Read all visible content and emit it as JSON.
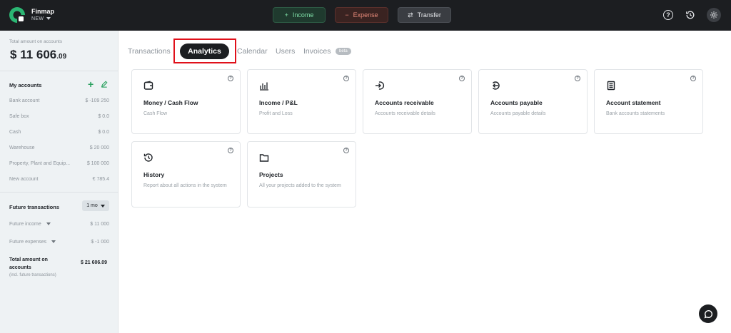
{
  "brand": {
    "name": "Finmap",
    "workspace": "NEW"
  },
  "topbar": {
    "income_label": "Income",
    "expense_label": "Expense",
    "transfer_label": "Transfer",
    "income_icon": "+",
    "expense_icon": "−",
    "transfer_icon": "⇄"
  },
  "sidebar": {
    "total_label": "Total amount on accounts",
    "total_currency": "$",
    "total_main": "11 606",
    "total_cents": ".09",
    "accounts_title": "My accounts",
    "accounts": [
      {
        "name": "Bank account",
        "value": "$ -109 250"
      },
      {
        "name": "Safe box",
        "value": "$ 0.0"
      },
      {
        "name": "Cash",
        "value": "$ 0.0"
      },
      {
        "name": "Warehouse",
        "value": "$ 20 000"
      },
      {
        "name": "Property, Plant and Equip...",
        "value": "$ 100 000"
      },
      {
        "name": "New account",
        "value": "€ 785.4"
      }
    ],
    "future_title": "Future transactions",
    "future_period": "1 mo",
    "future_income_label": "Future income",
    "future_income_value": "$ 11 000",
    "future_expenses_label": "Future expenses",
    "future_expenses_value": "$ -1 000",
    "grand_total_label": "Total amount on accounts",
    "grand_total_value": "$ 21 606.09",
    "grand_total_note": "(incl. future transactions)"
  },
  "tabs": {
    "transactions": "Transactions",
    "analytics": "Analytics",
    "calendar": "Calendar",
    "users": "Users",
    "invoices": "Invoices",
    "invoices_badge": "beta"
  },
  "cards": [
    {
      "title": "Money / Cash Flow",
      "desc": "Cash Flow",
      "icon": "wallet-icon"
    },
    {
      "title": "Income / P&L",
      "desc": "Profit and Loss",
      "icon": "bar-chart-icon"
    },
    {
      "title": "Accounts receivable",
      "desc": "Accounts receivable details",
      "icon": "arrow-in-icon"
    },
    {
      "title": "Accounts payable",
      "desc": "Accounts payable details",
      "icon": "arrow-out-icon"
    },
    {
      "title": "Account statement",
      "desc": "Bank accounts statements",
      "icon": "document-icon"
    },
    {
      "title": "History",
      "desc": "Report about all actions in the system",
      "icon": "history-icon"
    },
    {
      "title": "Projects",
      "desc": "All your projects added to the system",
      "icon": "folder-icon"
    }
  ],
  "colors": {
    "accent_green": "#2aa15f",
    "highlight": "#e0101a",
    "dark": "#1c1e21"
  }
}
